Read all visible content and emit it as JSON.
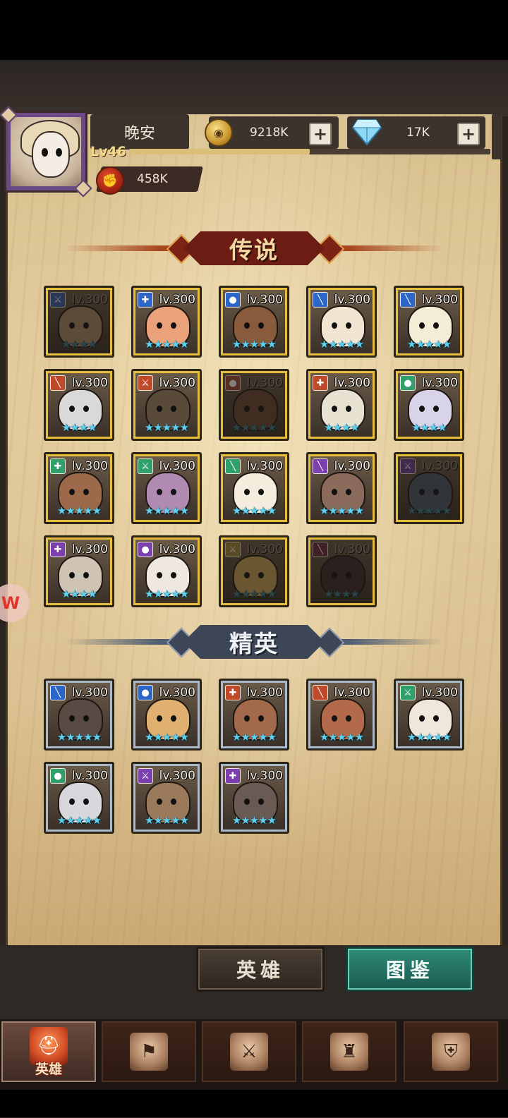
{
  "player": {
    "name": "晚安",
    "level": "Lv46",
    "xp_fraction": 0.5,
    "power": "458K"
  },
  "resources": {
    "gold": "9218K",
    "diamonds": "17K"
  },
  "sections": {
    "legend_title": "传说",
    "elite_title": "精英"
  },
  "legend_heroes": [
    {
      "level": "lv.300",
      "stars": "★★★★",
      "class_color": "#3b5da8",
      "class_icon": "⚔",
      "locked": true,
      "face": "#a88a68"
    },
    {
      "level": "lv.300",
      "stars": "★★★★★",
      "class_color": "#2c66c8",
      "class_icon": "✚",
      "locked": false,
      "face": "#e9a27a"
    },
    {
      "level": "lv.300",
      "stars": "★★★★★",
      "class_color": "#2c66c8",
      "class_icon": "●",
      "locked": false,
      "face": "#8a5a3c"
    },
    {
      "level": "lv.300",
      "stars": "★★★★★",
      "class_color": "#2c66c8",
      "class_icon": "╲",
      "locked": false,
      "face": "#f2e6d2"
    },
    {
      "level": "lv.300",
      "stars": "★★★★★",
      "class_color": "#2c66c8",
      "class_icon": "╲",
      "locked": false,
      "face": "#f5ecd6"
    },
    {
      "level": "lv.300",
      "stars": "★★★★",
      "class_color": "#c0492a",
      "class_icon": "╲",
      "locked": false,
      "face": "#d9d9d9"
    },
    {
      "level": "lv.300",
      "stars": "★★★★★",
      "class_color": "#c0492a",
      "class_icon": "⚔",
      "locked": false,
      "face": "#5a4a3a"
    },
    {
      "level": "lv.300",
      "stars": "★★★★★",
      "class_color": "#a3472f",
      "class_icon": "●",
      "locked": true,
      "face": "#6a4632"
    },
    {
      "level": "lv.300",
      "stars": "★★★★",
      "class_color": "#c0492a",
      "class_icon": "✚",
      "locked": false,
      "face": "#e8e2d3"
    },
    {
      "level": "lv.300",
      "stars": "★★★★",
      "class_color": "#2f9f6b",
      "class_icon": "●",
      "locked": false,
      "face": "#d9d3ea"
    },
    {
      "level": "lv.300",
      "stars": "★★★★★",
      "class_color": "#2f9f6b",
      "class_icon": "✚",
      "locked": false,
      "face": "#9c6a4a"
    },
    {
      "level": "lv.300",
      "stars": "★★★★★",
      "class_color": "#2f9f6b",
      "class_icon": "⚔",
      "locked": false,
      "face": "#b08ab0"
    },
    {
      "level": "lv.300",
      "stars": "★★★★★",
      "class_color": "#2f9f6b",
      "class_icon": "╲",
      "locked": false,
      "face": "#f4ecdc"
    },
    {
      "level": "lv.300",
      "stars": "★★★★★",
      "class_color": "#7b3fb0",
      "class_icon": "╲",
      "locked": false,
      "face": "#8a6a5a"
    },
    {
      "level": "lv.300",
      "stars": "★★★★★",
      "class_color": "#6a3f8e",
      "class_icon": "⚔",
      "locked": true,
      "face": "#4a5a6a"
    },
    {
      "level": "lv.300",
      "stars": "★★★★",
      "class_color": "#7b3fb0",
      "class_icon": "✚",
      "locked": false,
      "face": "#cfc4b4"
    },
    {
      "level": "lv.300",
      "stars": "★★★★★",
      "class_color": "#7b3fb0",
      "class_icon": "●",
      "locked": false,
      "face": "#eee8e0"
    },
    {
      "level": "lv.300",
      "stars": "★★★★★",
      "class_color": "#a08a3a",
      "class_icon": "⚔",
      "locked": true,
      "face": "#c9a35a"
    },
    {
      "level": "lv.300",
      "stars": "★★★★",
      "class_color": "#6a2a40",
      "class_icon": "╲",
      "locked": true,
      "face": "#3a2a2a"
    }
  ],
  "elite_heroes": [
    {
      "level": "lv.300",
      "stars": "★★★★★",
      "class_color": "#2c66c8",
      "class_icon": "╲",
      "locked": false,
      "face": "#5a4a44"
    },
    {
      "level": "lv.300",
      "stars": "★★★★★",
      "class_color": "#2c66c8",
      "class_icon": "●",
      "locked": false,
      "face": "#e0b070"
    },
    {
      "level": "lv.300",
      "stars": "★★★★★",
      "class_color": "#c0492a",
      "class_icon": "✚",
      "locked": false,
      "face": "#a26a4a"
    },
    {
      "level": "lv.300",
      "stars": "★★★★★",
      "class_color": "#c0492a",
      "class_icon": "╲",
      "locked": false,
      "face": "#b26a4a"
    },
    {
      "level": "lv.300",
      "stars": "★★★★★",
      "class_color": "#2f9f6b",
      "class_icon": "⚔",
      "locked": false,
      "face": "#f0e6dc"
    },
    {
      "level": "lv.300",
      "stars": "★★★★★",
      "class_color": "#2f9f6b",
      "class_icon": "●",
      "locked": false,
      "face": "#d8d8dc"
    },
    {
      "level": "lv.300",
      "stars": "★★★★★",
      "class_color": "#7b3fb0",
      "class_icon": "⚔",
      "locked": false,
      "face": "#9a7a5a"
    },
    {
      "level": "lv.300",
      "stars": "★★★★★",
      "class_color": "#7b3fb0",
      "class_icon": "✚",
      "locked": false,
      "face": "#6a5a54"
    }
  ],
  "mode_buttons": {
    "heroes": "英雄",
    "codex": "图鉴"
  },
  "tabs": [
    {
      "label": "英雄",
      "icon": "helmet-icon",
      "glyph": "⛑",
      "active": true
    },
    {
      "label": "",
      "icon": "flag-icon",
      "glyph": "⚑",
      "active": false
    },
    {
      "label": "",
      "icon": "crossed-swords-icon",
      "glyph": "⚔",
      "active": false
    },
    {
      "label": "",
      "icon": "castle-icon",
      "glyph": "♜",
      "active": false
    },
    {
      "label": "",
      "icon": "guild-shield-icon",
      "glyph": "⛨",
      "active": false
    }
  ],
  "colors": {
    "legend_frame": "#e6be3c",
    "elite_frame": "#aab8c7",
    "star": "#5fd1ee"
  }
}
